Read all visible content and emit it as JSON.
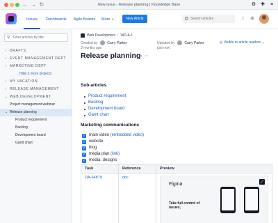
{
  "window": {
    "title": "New issue - Release planning | Knowledge Base",
    "back_icon": "←",
    "forward_icon": "→",
    "reload_icon": "↻"
  },
  "header": {
    "tabs": [
      {
        "label": "Issues",
        "active": true
      },
      {
        "label": "Dashboards"
      },
      {
        "label": "Agile Boards"
      },
      {
        "label": "More"
      }
    ],
    "new_article_label": "New Article",
    "search_placeholder": "Search articles"
  },
  "sidebar": {
    "filter_placeholder": "Filter articles by title",
    "items": [
      {
        "label": "DRAFTS"
      },
      {
        "label": "EVENT MANAGEMENT DEPT"
      },
      {
        "label": "MARKETING DEPT"
      },
      {
        "label": "Hide 3 more projects"
      },
      {
        "label": "MY VACATION"
      },
      {
        "label": "RELEASE MANAGEMENT"
      },
      {
        "label": "WEB DEVELOPMENT"
      },
      {
        "label": "Project management webinar"
      },
      {
        "label": "Release planning"
      },
      {
        "label": "Product requirement"
      },
      {
        "label": "Backlog"
      },
      {
        "label": "Development board"
      },
      {
        "label": "Gantt chart"
      }
    ]
  },
  "article": {
    "breadcrumb_space": "Web Development",
    "breadcrumb_id": "WD-A-1",
    "created_by_label": "Created by",
    "created_by": "Carry Parker",
    "created_ago": "3 months ago",
    "updated_by_label": "Updated by",
    "updated_by": "Carry Parker",
    "updated_ago": "just now",
    "visibility": "Visible to article readers",
    "title": "Release planning",
    "subarticles_heading": "Sub-articles",
    "subarticles": [
      "Product requirement",
      "Backlog",
      "Development board",
      "Gantt chart"
    ],
    "comms_heading": "Marketing communications",
    "checklist": [
      {
        "text": "main video",
        "link": "(embedded video)"
      },
      {
        "text": "website",
        "link": ""
      },
      {
        "text": "blog",
        "link": ""
      },
      {
        "text": "media plan",
        "link": "(link)"
      },
      {
        "text": "media: designs",
        "link": ""
      }
    ],
    "table": {
      "headers": [
        "Task",
        "Reference",
        "Preview"
      ],
      "row": {
        "task": "DA-64879",
        "reference": "doc",
        "preview_title": "Figma",
        "preview_text": "Take full control of issues,"
      }
    }
  }
}
